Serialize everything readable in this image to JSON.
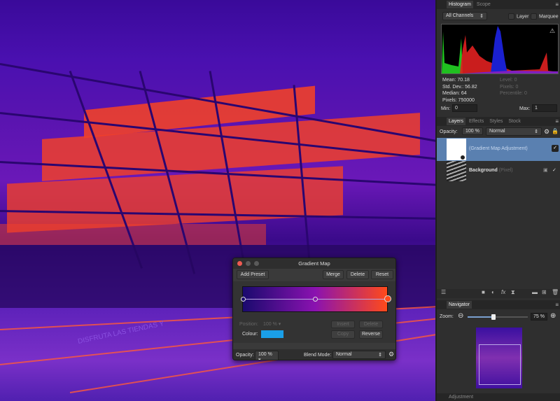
{
  "histogram_panel": {
    "tabs": [
      "Histogram",
      "Scope"
    ],
    "channel": "All Channels",
    "layer_label": "Layer",
    "marquee_label": "Marquee",
    "stats": {
      "mean": "Mean: 70.18",
      "std": "Std. Dev.: 56.82",
      "median": "Median: 64",
      "pixels": "Pixels: 750000",
      "level": "Level: 0",
      "pixels_sel": "Pixels: 0",
      "percentile": "Percentile: 0"
    },
    "min_label": "Min:",
    "min_value": "0",
    "max_label": "Max:",
    "max_value": "1"
  },
  "layers_panel": {
    "tabs": [
      "Layers",
      "Effects",
      "Styles",
      "Stock"
    ],
    "opacity_label": "Opacity:",
    "opacity_value": "100 %",
    "blend": "Normal",
    "layers": [
      {
        "name": "(Gradient Map Adjustment)",
        "type": ""
      },
      {
        "name": "Background",
        "type": "(Pixel)"
      }
    ]
  },
  "navigator_panel": {
    "tab": "Navigator",
    "zoom_label": "Zoom:",
    "zoom_value": "75 %",
    "zoom_fraction": 0.4
  },
  "adjustment_panel": {
    "tab": "Adjustment"
  },
  "dialog": {
    "title": "Gradient Map",
    "add_preset": "Add Preset",
    "merge": "Merge",
    "delete": "Delete",
    "reset": "Reset",
    "gradient_colors": [
      "#1a0a6e",
      "#8a12b0",
      "#ff4a1a"
    ],
    "stops": [
      0,
      0.5,
      1
    ],
    "position_label": "Position:",
    "position_value": "100 %",
    "insert": "Insert",
    "delete_stop": "Delete",
    "colour_label": "Colour:",
    "colour": "#1a9fe8",
    "copy": "Copy",
    "reverse": "Reverse",
    "opacity_label": "Opacity:",
    "opacity_value": "100 %",
    "blend_label": "Blend Mode:",
    "blend_value": "Normal"
  },
  "canvas": {
    "sign_text": "DISFRUTA LAS TIENDAS Y"
  }
}
